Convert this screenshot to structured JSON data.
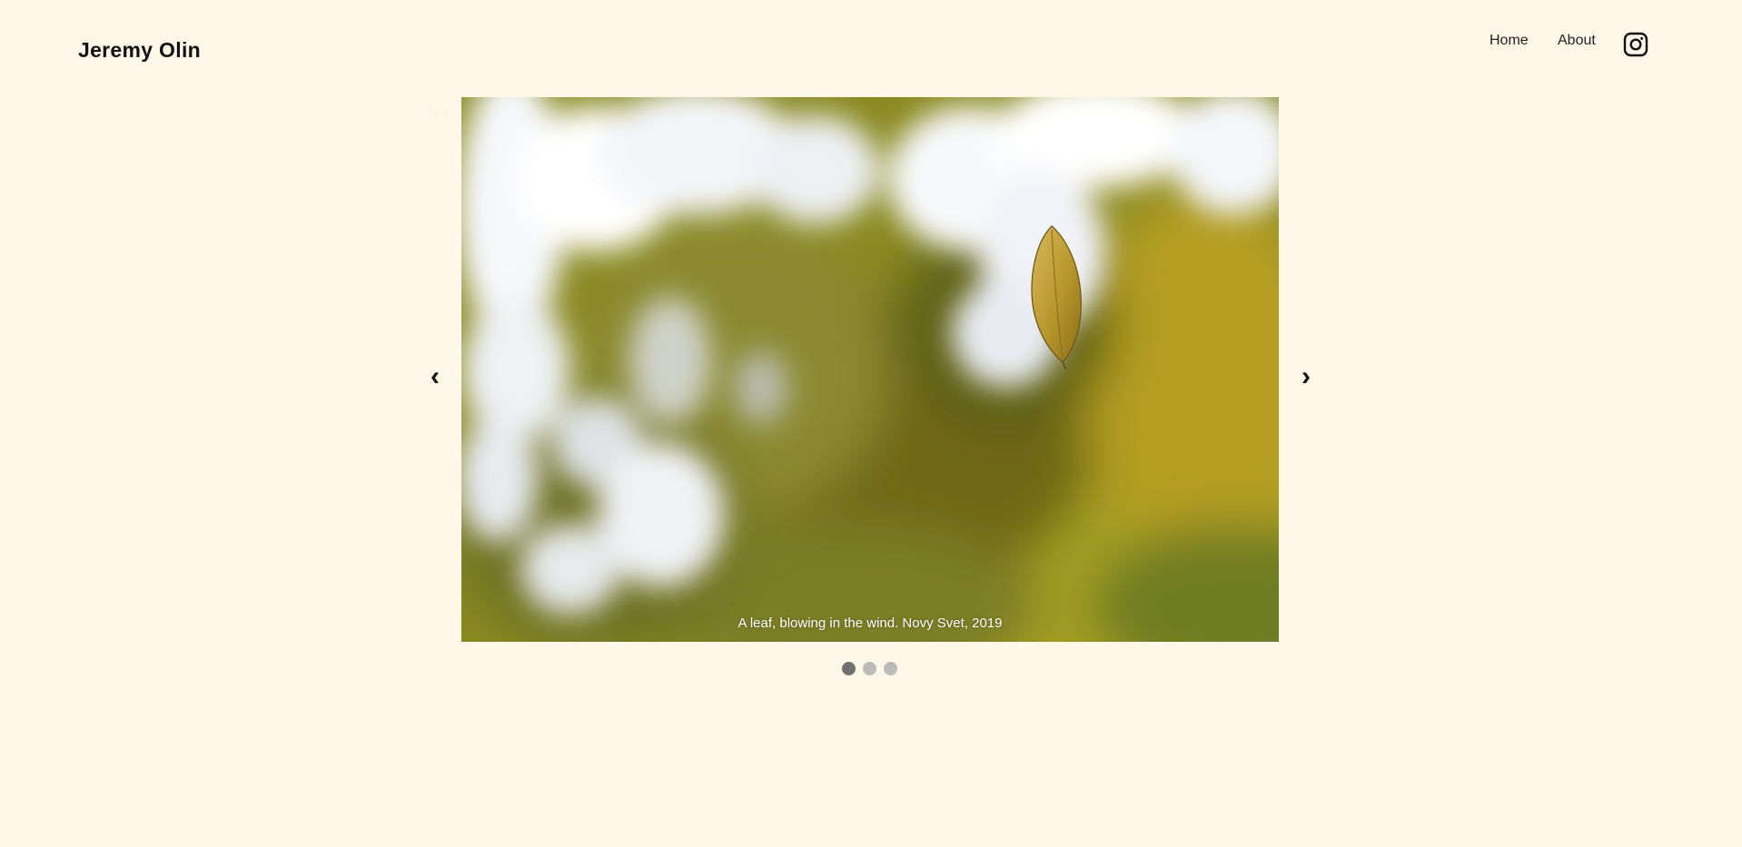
{
  "header": {
    "site_title": "Jeremy Olin",
    "nav": [
      {
        "label": "Home"
      },
      {
        "label": "About"
      }
    ],
    "social_icon": "instagram-icon"
  },
  "slideshow": {
    "slide_number": "1 / 3",
    "current_slide": 1,
    "total_slides": 3,
    "caption": "A leaf, blowing in the wind. Novy Svet, 2019",
    "prev_label": "‹",
    "next_label": "›",
    "active_dot": 1
  },
  "colors": {
    "background": "#fff7e8",
    "text": "#111111",
    "dot_inactive": "#bbbbbb",
    "dot_active": "#717171",
    "caption": "#ffffff"
  }
}
